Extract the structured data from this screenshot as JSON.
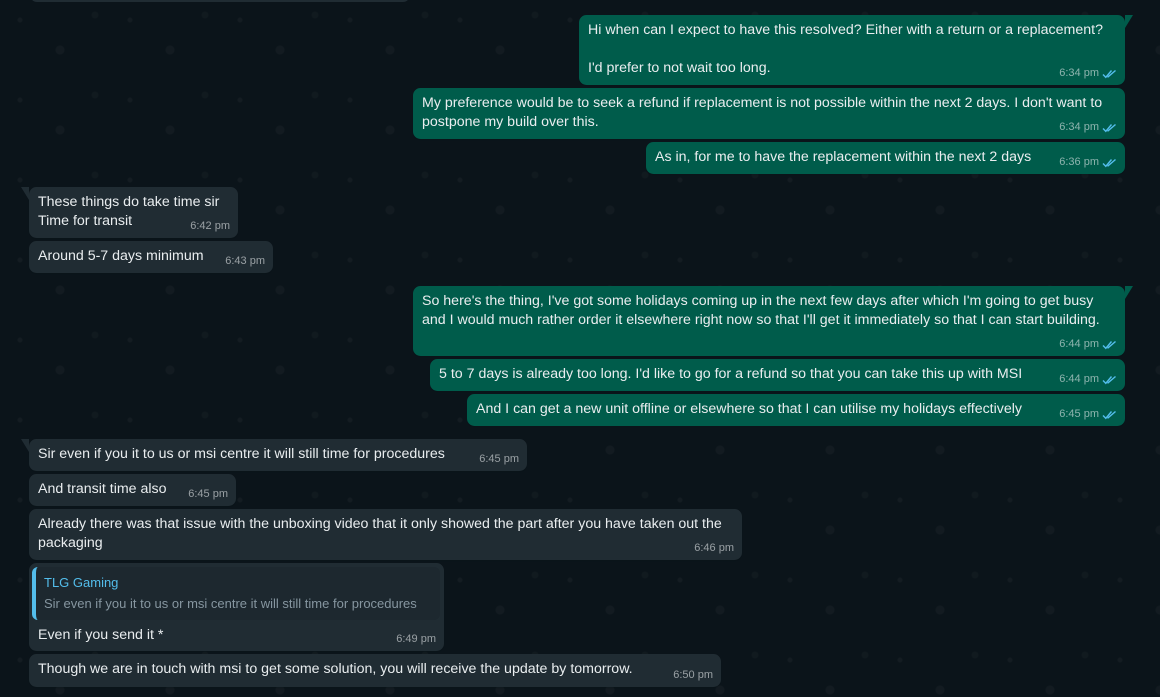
{
  "colors": {
    "background": "#0b141a",
    "outgoing_bubble": "#005c4b",
    "incoming_bubble": "#202c33",
    "read_tick": "#53bdeb",
    "quote_author": "#53bdeb"
  },
  "messages": [
    {
      "direction": "out",
      "text": "Hi when can I expect to have this resolved? Either with a return or a replacement?\n\nI'd prefer to not wait too long.",
      "time": "6:34 pm",
      "status_icon": "double-check-read-icon"
    },
    {
      "direction": "out",
      "text": "My preference would be to seek a refund if replacement is not possible within the next 2 days. I don't want to postpone my build over this.",
      "time": "6:34 pm",
      "status_icon": "double-check-read-icon"
    },
    {
      "direction": "out",
      "text": "As in, for me to have the replacement within the next 2 days",
      "time": "6:36 pm",
      "status_icon": "double-check-read-icon"
    },
    {
      "direction": "in",
      "text": "These things do take time sir\nTime for transit",
      "time": "6:42 pm"
    },
    {
      "direction": "in",
      "text": "Around 5-7 days minimum",
      "time": "6:43 pm"
    },
    {
      "direction": "out",
      "text": "So here's the thing, I've got some holidays coming up in the next few days after which I'm going to get busy and I would much rather order it elsewhere right now so that I'll get it immediately so that I can start building.",
      "time": "6:44 pm",
      "status_icon": "double-check-read-icon"
    },
    {
      "direction": "out",
      "text": "5 to 7 days is already too long. I'd like to go for a refund so that you can take this up with MSI",
      "time": "6:44 pm",
      "status_icon": "double-check-read-icon"
    },
    {
      "direction": "out",
      "text": "And I can get a new unit offline or elsewhere so that I can utilise my holidays effectively",
      "time": "6:45 pm",
      "status_icon": "double-check-read-icon"
    },
    {
      "direction": "in",
      "text": "Sir even if you it to us or msi centre it will still time for procedures",
      "time": "6:45 pm"
    },
    {
      "direction": "in",
      "text": "And transit time also",
      "time": "6:45 pm"
    },
    {
      "direction": "in",
      "text": "Already there was that issue with the unboxing video that it only showed the part after you have taken out the packaging",
      "time": "6:46 pm"
    },
    {
      "direction": "in",
      "quote_author": "TLG Gaming",
      "quote_text": "Sir even if you it to us or msi centre it will still time for procedures",
      "text": "Even if you send it *",
      "time": "6:49 pm"
    },
    {
      "direction": "in",
      "text": "Though we are in touch with msi to get some solution, you will receive the update by tomorrow.",
      "time": "6:50 pm"
    }
  ]
}
